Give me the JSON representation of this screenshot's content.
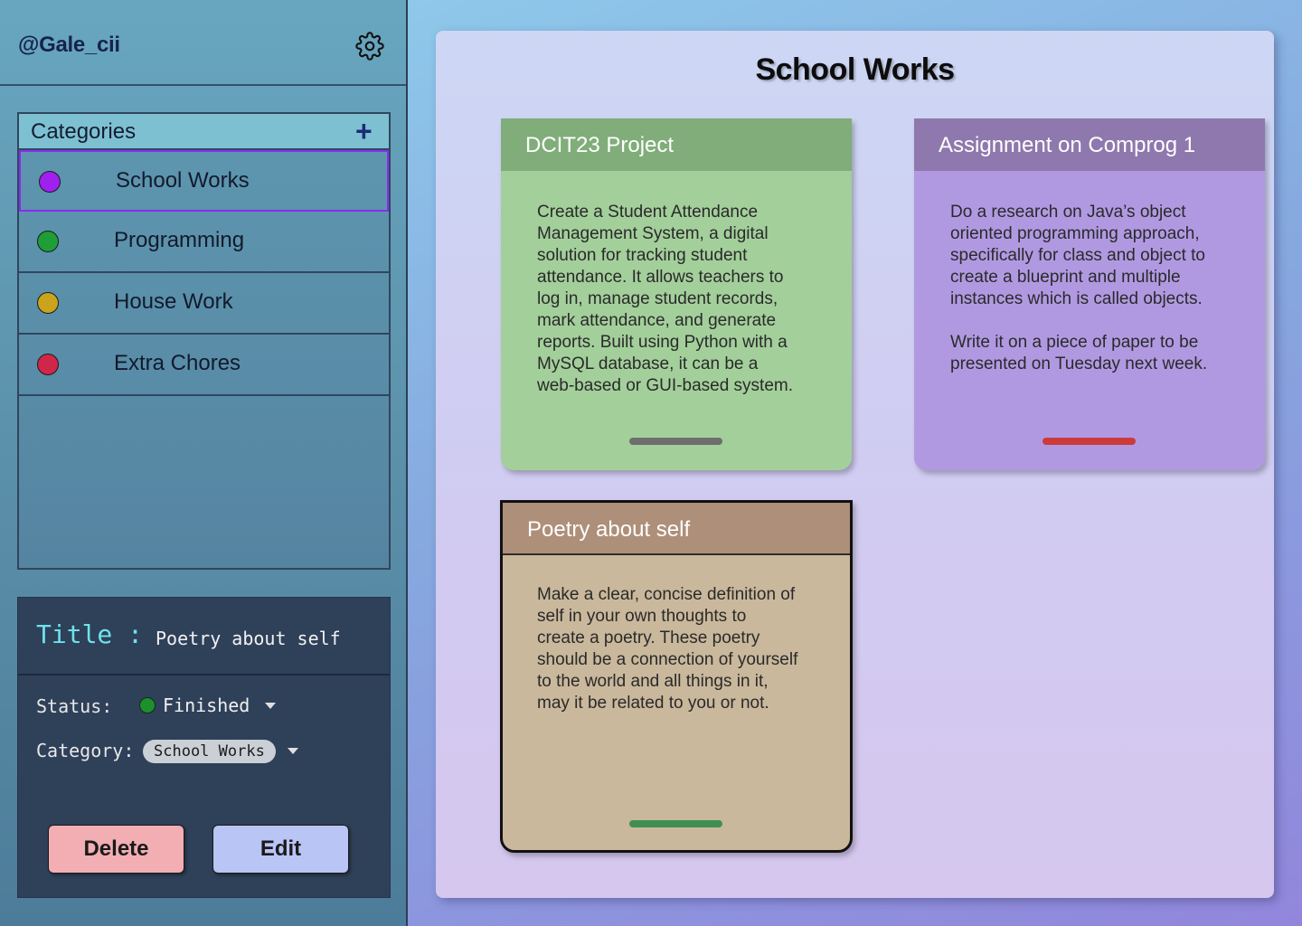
{
  "sidebar": {
    "username": "@Gale_cii",
    "settings_icon": "gear-icon",
    "categories": {
      "title": "Categories",
      "add_label": "+",
      "items": [
        {
          "label": "School Works",
          "color": "#a020f0",
          "selected": true
        },
        {
          "label": "Programming",
          "color": "#1f9e37"
        },
        {
          "label": "House Work",
          "color": "#c9a41c"
        },
        {
          "label": "Extra Chores",
          "color": "#d0264a"
        }
      ]
    },
    "details": {
      "title_key": "Title",
      "title_sep": ":",
      "title_value": "Poetry about self",
      "status_label": "Status:",
      "status_value": "Finished",
      "status_color": "#1f8e2f",
      "category_label": "Category:",
      "category_value": "School Works",
      "delete_label": "Delete",
      "edit_label": "Edit"
    }
  },
  "main": {
    "title": "School Works",
    "cards": [
      {
        "title": "DCIT23 Project",
        "body": "Create a Student Attendance\nManagement System, a digital\nsolution for tracking student\nattendance. It allows teachers to\nlog in, manage student records,\nmark attendance, and generate\nreports. Built using Python with a\nMySQL database, it can be a\nweb-based or GUI-based system.",
        "status_color": "#6e6e6e"
      },
      {
        "title": "Assignment on Comprog 1",
        "body": "Do a research on Java’s object\noriented programming approach,\nspecifically for class and object to\ncreate a blueprint and multiple\ninstances which is called objects.\n\nWrite it on a piece of paper to be\npresented on Tuesday next week.",
        "status_color": "#cc3b3b"
      },
      {
        "title": "Poetry about self",
        "body": "Make a clear, concise definition of\nself in your own thoughts to\ncreate a poetry. These poetry\nshould be a connection of yourself\nto the world and all things in it,\nmay it be related to you or not.",
        "status_color": "#3f8f55"
      }
    ]
  }
}
